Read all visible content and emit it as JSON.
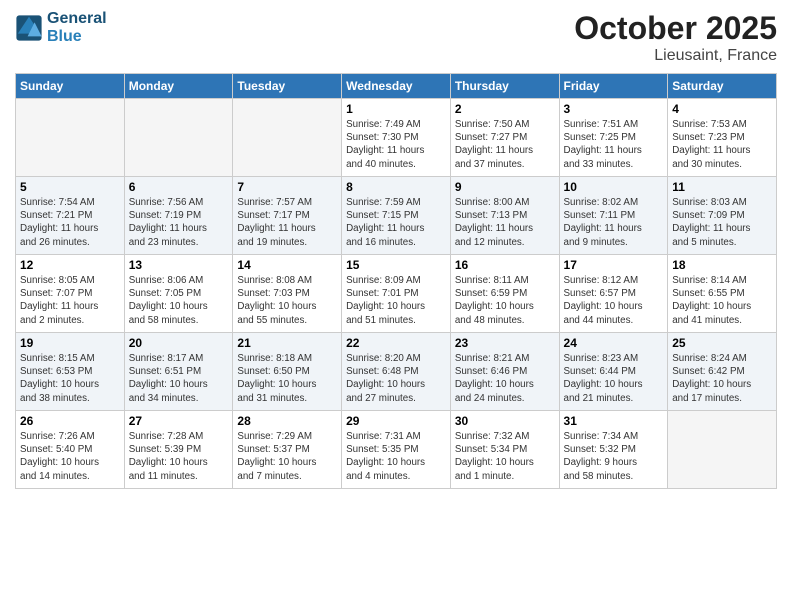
{
  "header": {
    "logo_line1": "General",
    "logo_line2": "Blue",
    "month": "October 2025",
    "location": "Lieusaint, France"
  },
  "weekdays": [
    "Sunday",
    "Monday",
    "Tuesday",
    "Wednesday",
    "Thursday",
    "Friday",
    "Saturday"
  ],
  "weeks": [
    [
      {
        "day": "",
        "info": ""
      },
      {
        "day": "",
        "info": ""
      },
      {
        "day": "",
        "info": ""
      },
      {
        "day": "1",
        "info": "Sunrise: 7:49 AM\nSunset: 7:30 PM\nDaylight: 11 hours\nand 40 minutes."
      },
      {
        "day": "2",
        "info": "Sunrise: 7:50 AM\nSunset: 7:27 PM\nDaylight: 11 hours\nand 37 minutes."
      },
      {
        "day": "3",
        "info": "Sunrise: 7:51 AM\nSunset: 7:25 PM\nDaylight: 11 hours\nand 33 minutes."
      },
      {
        "day": "4",
        "info": "Sunrise: 7:53 AM\nSunset: 7:23 PM\nDaylight: 11 hours\nand 30 minutes."
      }
    ],
    [
      {
        "day": "5",
        "info": "Sunrise: 7:54 AM\nSunset: 7:21 PM\nDaylight: 11 hours\nand 26 minutes."
      },
      {
        "day": "6",
        "info": "Sunrise: 7:56 AM\nSunset: 7:19 PM\nDaylight: 11 hours\nand 23 minutes."
      },
      {
        "day": "7",
        "info": "Sunrise: 7:57 AM\nSunset: 7:17 PM\nDaylight: 11 hours\nand 19 minutes."
      },
      {
        "day": "8",
        "info": "Sunrise: 7:59 AM\nSunset: 7:15 PM\nDaylight: 11 hours\nand 16 minutes."
      },
      {
        "day": "9",
        "info": "Sunrise: 8:00 AM\nSunset: 7:13 PM\nDaylight: 11 hours\nand 12 minutes."
      },
      {
        "day": "10",
        "info": "Sunrise: 8:02 AM\nSunset: 7:11 PM\nDaylight: 11 hours\nand 9 minutes."
      },
      {
        "day": "11",
        "info": "Sunrise: 8:03 AM\nSunset: 7:09 PM\nDaylight: 11 hours\nand 5 minutes."
      }
    ],
    [
      {
        "day": "12",
        "info": "Sunrise: 8:05 AM\nSunset: 7:07 PM\nDaylight: 11 hours\nand 2 minutes."
      },
      {
        "day": "13",
        "info": "Sunrise: 8:06 AM\nSunset: 7:05 PM\nDaylight: 10 hours\nand 58 minutes."
      },
      {
        "day": "14",
        "info": "Sunrise: 8:08 AM\nSunset: 7:03 PM\nDaylight: 10 hours\nand 55 minutes."
      },
      {
        "day": "15",
        "info": "Sunrise: 8:09 AM\nSunset: 7:01 PM\nDaylight: 10 hours\nand 51 minutes."
      },
      {
        "day": "16",
        "info": "Sunrise: 8:11 AM\nSunset: 6:59 PM\nDaylight: 10 hours\nand 48 minutes."
      },
      {
        "day": "17",
        "info": "Sunrise: 8:12 AM\nSunset: 6:57 PM\nDaylight: 10 hours\nand 44 minutes."
      },
      {
        "day": "18",
        "info": "Sunrise: 8:14 AM\nSunset: 6:55 PM\nDaylight: 10 hours\nand 41 minutes."
      }
    ],
    [
      {
        "day": "19",
        "info": "Sunrise: 8:15 AM\nSunset: 6:53 PM\nDaylight: 10 hours\nand 38 minutes."
      },
      {
        "day": "20",
        "info": "Sunrise: 8:17 AM\nSunset: 6:51 PM\nDaylight: 10 hours\nand 34 minutes."
      },
      {
        "day": "21",
        "info": "Sunrise: 8:18 AM\nSunset: 6:50 PM\nDaylight: 10 hours\nand 31 minutes."
      },
      {
        "day": "22",
        "info": "Sunrise: 8:20 AM\nSunset: 6:48 PM\nDaylight: 10 hours\nand 27 minutes."
      },
      {
        "day": "23",
        "info": "Sunrise: 8:21 AM\nSunset: 6:46 PM\nDaylight: 10 hours\nand 24 minutes."
      },
      {
        "day": "24",
        "info": "Sunrise: 8:23 AM\nSunset: 6:44 PM\nDaylight: 10 hours\nand 21 minutes."
      },
      {
        "day": "25",
        "info": "Sunrise: 8:24 AM\nSunset: 6:42 PM\nDaylight: 10 hours\nand 17 minutes."
      }
    ],
    [
      {
        "day": "26",
        "info": "Sunrise: 7:26 AM\nSunset: 5:40 PM\nDaylight: 10 hours\nand 14 minutes."
      },
      {
        "day": "27",
        "info": "Sunrise: 7:28 AM\nSunset: 5:39 PM\nDaylight: 10 hours\nand 11 minutes."
      },
      {
        "day": "28",
        "info": "Sunrise: 7:29 AM\nSunset: 5:37 PM\nDaylight: 10 hours\nand 7 minutes."
      },
      {
        "day": "29",
        "info": "Sunrise: 7:31 AM\nSunset: 5:35 PM\nDaylight: 10 hours\nand 4 minutes."
      },
      {
        "day": "30",
        "info": "Sunrise: 7:32 AM\nSunset: 5:34 PM\nDaylight: 10 hours\nand 1 minute."
      },
      {
        "day": "31",
        "info": "Sunrise: 7:34 AM\nSunset: 5:32 PM\nDaylight: 9 hours\nand 58 minutes."
      },
      {
        "day": "",
        "info": ""
      }
    ]
  ]
}
